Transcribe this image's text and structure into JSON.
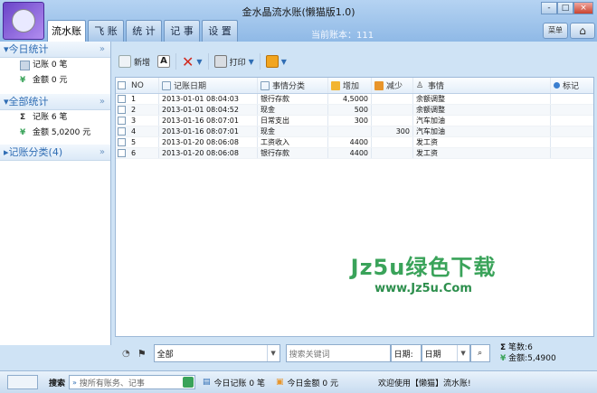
{
  "window": {
    "title": "金水晶流水账(懒猫版1.0)",
    "controls": [
      "-",
      "□",
      "×"
    ]
  },
  "tabs": [
    {
      "label": "流水账",
      "active": true
    },
    {
      "label": "飞 账",
      "active": false
    },
    {
      "label": "统 计",
      "active": false
    },
    {
      "label": "记 事",
      "active": false
    },
    {
      "label": "设 置",
      "active": false
    }
  ],
  "current_book": "当前账本：111",
  "top_icons": {
    "menu": "菜单",
    "home": "⌂"
  },
  "sidebar": {
    "today": {
      "heading": "今日统计",
      "count_label": "记账 0 笔",
      "amount_label": "金额 0 元"
    },
    "all": {
      "heading": "全部统计",
      "count_label": "记账 6 笔",
      "amount_label": "金额 5,0200 元"
    },
    "category": {
      "heading": "记账分类(4)"
    }
  },
  "toolbar": {
    "new_label": "新增",
    "print_label": "打印"
  },
  "table": {
    "headers": {
      "no": "NO",
      "date": "记账日期",
      "category": "事情分类",
      "income": "增加",
      "expense": "减少",
      "note": "事情",
      "mark": "标记"
    },
    "rows": [
      {
        "no": "1",
        "date": "2013-01-01 08:04:03",
        "category": "银行存款",
        "income": "4,5000",
        "expense": "",
        "note": "余额调整"
      },
      {
        "no": "2",
        "date": "2013-01-01 08:04:52",
        "category": "现金",
        "income": "500",
        "expense": "",
        "note": "余额调整"
      },
      {
        "no": "3",
        "date": "2013-01-16 08:07:01",
        "category": "日常支出",
        "income": "300",
        "expense": "",
        "note": "汽车加油"
      },
      {
        "no": "4",
        "date": "2013-01-16 08:07:01",
        "category": "现金",
        "income": "",
        "expense": "300",
        "note": "汽车加油"
      },
      {
        "no": "5",
        "date": "2013-01-20 08:06:08",
        "category": "工资收入",
        "income": "4400",
        "expense": "",
        "note": "发工资"
      },
      {
        "no": "6",
        "date": "2013-01-20 08:06:08",
        "category": "银行存款",
        "income": "4400",
        "expense": "",
        "note": "发工资"
      }
    ]
  },
  "watermark": {
    "line1": "Jz5u绿色下载",
    "line2": "www.Jz5u.Com"
  },
  "filter": {
    "category_value": "全部",
    "search_placeholder": "搜索关键词",
    "date_label": "日期:",
    "date_value": "日期",
    "count_stat": "笔数:6",
    "amount_stat": "金额:5,4900"
  },
  "statusbar": {
    "search_label": "搜索",
    "search_placeholder": "搜所有账务、记事",
    "today_count": "今日记账 0 笔",
    "today_amount": "今日金额 0 元",
    "welcome": "欢迎使用【懒猫】流水账!"
  },
  "colors": {
    "accent": "#2f6db4",
    "titlebar": "#a9c8ea",
    "watermark": "#3aa35a",
    "danger": "#d02a1e"
  }
}
